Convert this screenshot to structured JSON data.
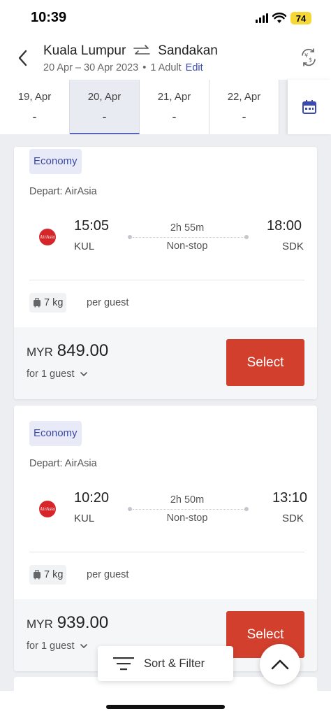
{
  "status": {
    "time": "10:39",
    "battery": "74"
  },
  "header": {
    "origin": "Kuala Lumpur",
    "destination": "Sandakan",
    "dates": "20 Apr – 30 Apr 2023",
    "separator": "•",
    "travellers": "1 Adult",
    "edit": "Edit"
  },
  "dates": [
    {
      "label": "19, Apr",
      "price": "-"
    },
    {
      "label": "20, Apr",
      "price": "-",
      "active": true
    },
    {
      "label": "21, Apr",
      "price": "-"
    },
    {
      "label": "22, Apr",
      "price": "-"
    }
  ],
  "flights": [
    {
      "cabin": "Economy",
      "depart": "Depart: AirAsia",
      "logo_text": "AirAsia",
      "dep_time": "15:05",
      "dep_airport": "KUL",
      "duration": "2h 55m",
      "stops": "Non-stop",
      "arr_time": "18:00",
      "arr_airport": "SDK",
      "baggage": "7 kg",
      "baggage_note": "per guest",
      "currency": "MYR",
      "amount": "849.00",
      "guests": "for 1 guest",
      "select": "Select"
    },
    {
      "cabin": "Economy",
      "depart": "Depart: AirAsia",
      "logo_text": "AirAsia",
      "dep_time": "10:20",
      "dep_airport": "KUL",
      "duration": "2h 50m",
      "stops": "Non-stop",
      "arr_time": "13:10",
      "arr_airport": "SDK",
      "baggage": "7 kg",
      "baggage_note": "per guest",
      "currency": "MYR",
      "amount": "939.00",
      "guests": "for 1 guest",
      "select": "Select"
    }
  ],
  "actions": {
    "sort_filter": "Sort & Filter"
  },
  "colors": {
    "accent": "#d23f2d",
    "link": "#3b4ab3",
    "badge": "#e8eaf8"
  }
}
